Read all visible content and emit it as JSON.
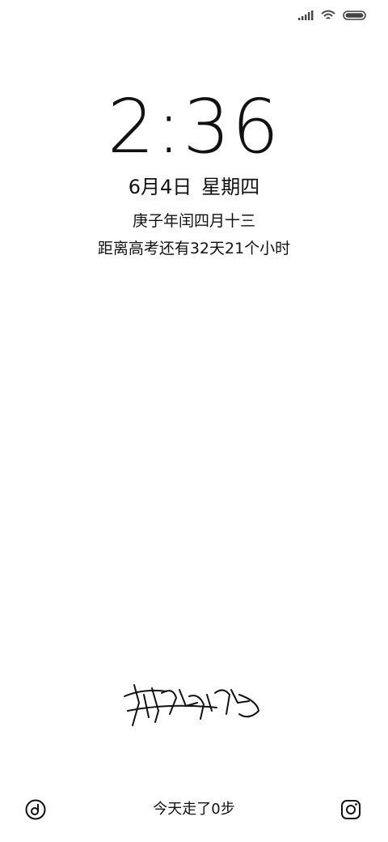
{
  "status_bar": {
    "icons": [
      "signal-icon",
      "wifi-icon",
      "battery-icon"
    ]
  },
  "lockscreen": {
    "time": "2:36",
    "date": "6月4日",
    "weekday": "星期四",
    "lunar": "庚子年闰四月十三",
    "countdown": "距离高考还有32天21个小时"
  },
  "signature": {
    "type": "handwritten-signature"
  },
  "bottom": {
    "left_icon": "music-icon",
    "steps_text": "今天走了0步",
    "right_icon": "camera-icon"
  }
}
